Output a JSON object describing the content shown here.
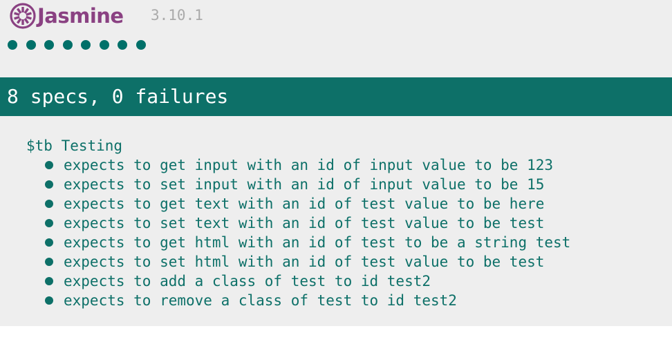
{
  "banner": {
    "title": "Jasmine",
    "version": "3.10.1",
    "logo_icon": "jasmine-flower-icon"
  },
  "symbol_summary": {
    "passed_count": 8,
    "status": "passed",
    "color": "#007069"
  },
  "alert": {
    "text": "8 specs, 0 failures",
    "color": "#0d7068"
  },
  "results": {
    "suites": [
      {
        "title": "$tb Testing",
        "specs": [
          {
            "label": "expects to get input with an id of input value to be 123"
          },
          {
            "label": "expects to set input with an id of input value to be 15"
          },
          {
            "label": "expects to get text with an id of test value to be here"
          },
          {
            "label": "expects to set text with an id of test value to be test"
          },
          {
            "label": "expects to get html with an id of test to be a string test"
          },
          {
            "label": "expects to set html with an id of test value to be test"
          },
          {
            "label": "expects to add a class of test to id test2"
          },
          {
            "label": "expects to remove a class of test to id test2"
          }
        ]
      }
    ]
  },
  "colors": {
    "brand": "#8a4182",
    "passed": "#0d7068",
    "background": "#eeeeee",
    "version": "#aaaaaa"
  }
}
